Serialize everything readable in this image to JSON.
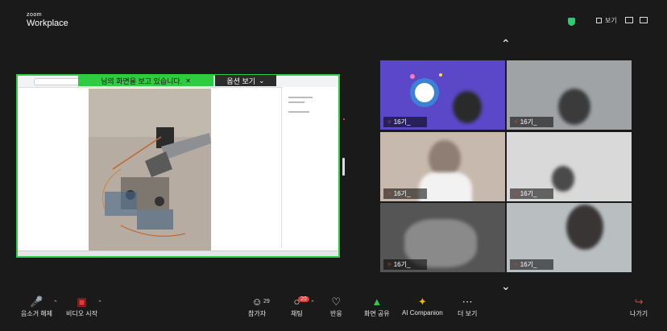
{
  "app": {
    "logo_top": "zoom",
    "logo_main": "Workplace"
  },
  "topbar": {
    "view_label": "보기"
  },
  "share": {
    "banner_text": "님의 화면을 보고 있습니다.",
    "options_label": "옵션 보기"
  },
  "participants": [
    {
      "name": "16기_"
    },
    {
      "name": "16기_"
    },
    {
      "name": "16기_"
    },
    {
      "name": "16기_"
    },
    {
      "name": "16기_"
    },
    {
      "name": "16기_"
    }
  ],
  "toolbar": {
    "mute_label": "음소거 해제",
    "video_label": "비디오 시작",
    "participants_label": "참가자",
    "participants_count": "29",
    "chat_label": "채팅",
    "chat_badge": "20",
    "reactions_label": "반응",
    "share_label": "화면 공유",
    "ai_label": "AI Companion",
    "more_label": "더 보기",
    "leave_label": "나가기"
  },
  "colors": {
    "accent_green": "#2ecc40",
    "mute_red": "#e53935",
    "background": "#1a1a1a"
  }
}
